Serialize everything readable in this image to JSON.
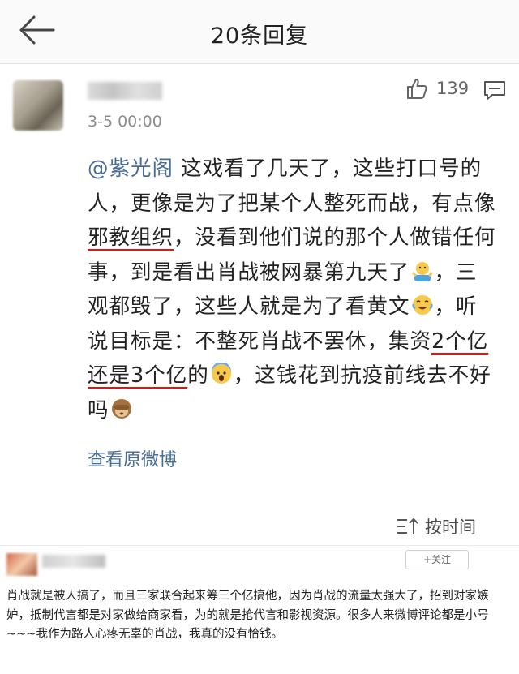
{
  "header": {
    "title": "20条回复"
  },
  "comment": {
    "timestamp": "3-5 00:00",
    "like_count": "139",
    "mention": "@紫光阁",
    "seg1": " 这戏看了几天了，这些打口号的人，更像是为了把某个人整死而战，有点像",
    "seg2": "邪教组织",
    "seg3": "，没看到他们说的那个人做错任何事，到是看出肖战被网暴第九天了",
    "seg4": "，三观都毁了，这些人就是为了看黄文",
    "seg5": "，听说目标是：不整死肖战不罢休，集资",
    "seg6": "2个亿还是3个亿",
    "seg7": "的",
    "seg8": "，这钱花到抗疫前线去不好吗",
    "view_original": "查看原微博"
  },
  "sort": {
    "label": "按时间"
  },
  "second_comment": {
    "follow_label": "+关注",
    "text": "肖战就是被人搞了，而且三家联合起来筹三个亿搞他，因为肖战的流量太强大了，招到对家嫉妒，抵制代言都是对家做给商家看，为的就是抢代言和影视资源。很多人来微博评论都是小号~~~我作为路人心疼无辜的肖战，我真的没有恰钱。"
  },
  "icons": {
    "back": "back-arrow-icon",
    "like": "thumbs-up-icon",
    "reply": "comment-bubble-icon",
    "sort": "sort-icon",
    "emoji_shrug": "shrug-emoji-icon",
    "emoji_laugh": "laugh-tears-emoji-icon",
    "emoji_scream": "scream-emoji-icon",
    "emoji_monkey": "see-no-evil-monkey-emoji-icon"
  },
  "colors": {
    "link": "#4a6d98",
    "underline": "#c8201d"
  }
}
